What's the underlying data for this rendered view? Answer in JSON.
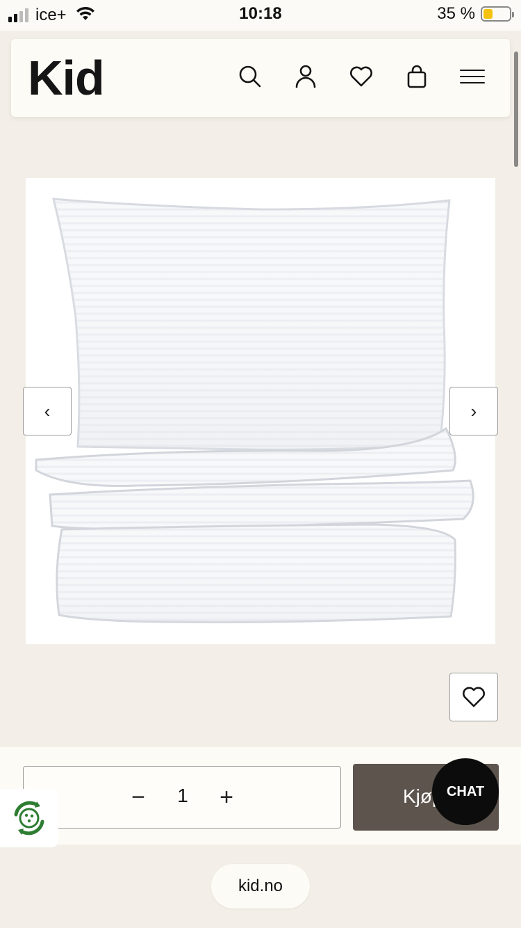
{
  "status_bar": {
    "carrier": "ice+",
    "time": "10:18",
    "battery_percent": "35 %",
    "battery_level": 0.35,
    "signal_bars_filled": 2
  },
  "header": {
    "logo": "Kid",
    "icons": [
      "search-icon",
      "user-icon",
      "heart-icon",
      "bag-icon",
      "menu-icon"
    ]
  },
  "carousel": {
    "prev_symbol": "‹",
    "next_symbol": "›"
  },
  "purchase": {
    "quantity": "1",
    "minus_symbol": "−",
    "plus_symbol": "+",
    "buy_label": "Kjøp"
  },
  "chat": {
    "label": "CHAT"
  },
  "browser": {
    "url": "kid.no"
  },
  "colors": {
    "page_bg": "#f3efe8",
    "header_bg": "#fdfbf6",
    "buy_button": "#5d544d",
    "chat_bubble": "#0c0c0c",
    "battery_fill": "#f4c20d",
    "recycle_green": "#2e7d32"
  }
}
